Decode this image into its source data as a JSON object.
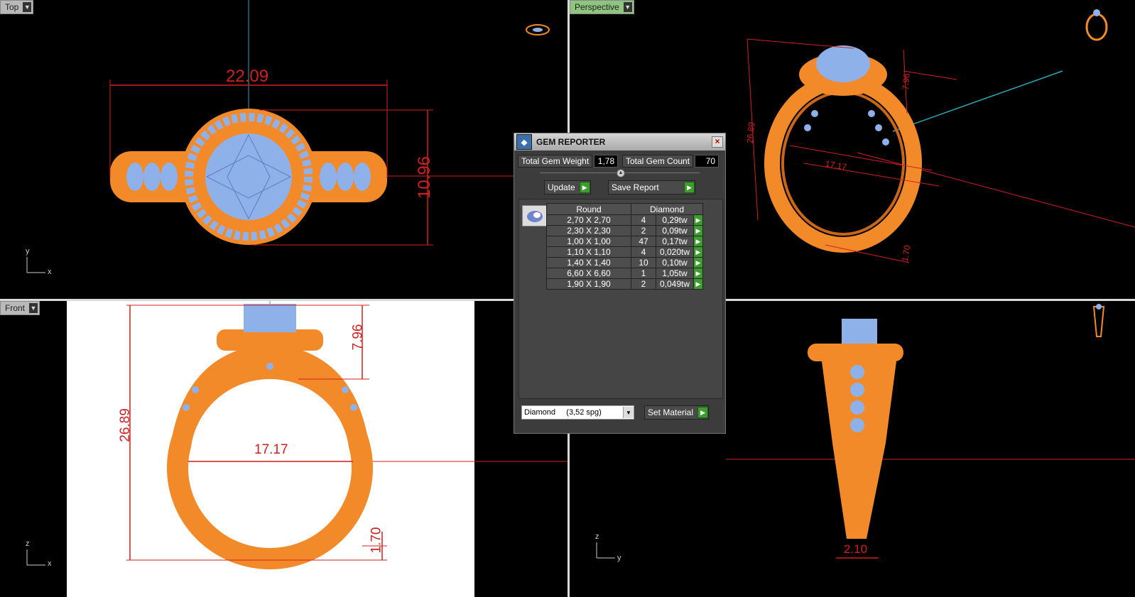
{
  "viewports": {
    "top": {
      "label": "Top",
      "dims": {
        "width": "22.09",
        "height": "10.96"
      },
      "axes": {
        "a": "y",
        "b": "x"
      }
    },
    "perspective": {
      "label": "Perspective",
      "dims": {
        "height": "26.89",
        "head": "7.96",
        "inner": "17.17",
        "band": "1.70"
      }
    },
    "front": {
      "label": "Front",
      "dims": {
        "height": "26.89",
        "head": "7.96",
        "inner": "17.17",
        "band": "1.70"
      },
      "axes": {
        "a": "z",
        "b": "x"
      }
    },
    "right": {
      "dims": {
        "shank": "2.10"
      },
      "axes": {
        "a": "z",
        "b": "y"
      }
    }
  },
  "gem_reporter": {
    "title": "GEM REPORTER",
    "close_glyph": "×",
    "total_weight_label": "Total Gem Weight",
    "total_weight_value": "1,78",
    "total_count_label": "Total Gem Count",
    "total_count_value": "70",
    "update_label": "Update",
    "save_report_label": "Save Report",
    "columns": [
      "Round",
      "Diamond"
    ],
    "rows": [
      {
        "size": "2,70 X 2,70",
        "count": "4",
        "weight": "0,29tw"
      },
      {
        "size": "2,30 X 2,30",
        "count": "2",
        "weight": "0,09tw"
      },
      {
        "size": "1,00 X 1,00",
        "count": "47",
        "weight": "0,17tw"
      },
      {
        "size": "1,10 X 1,10",
        "count": "4",
        "weight": "0,020tw"
      },
      {
        "size": "1,40 X 1,40",
        "count": "10",
        "weight": "0,10tw"
      },
      {
        "size": "6,60 X 6,60",
        "count": "1",
        "weight": "1,05tw"
      },
      {
        "size": "1,90 X 1,90",
        "count": "2",
        "weight": "0,049tw"
      }
    ],
    "material_value": "Diamond     (3,52 spg)",
    "set_material_label": "Set Material"
  },
  "colors": {
    "metal": "#f28a2a",
    "gem": "#8fb1ea",
    "dimension": "#d21f1f",
    "axis": "#2aa6b8",
    "button_green": "#3c9d2e"
  },
  "icons": [
    "dropdown-arrow-icon",
    "play-icon",
    "close-icon",
    "gem-reporter-logo-icon",
    "round-gem-icon",
    "ring-nav-icon"
  ]
}
